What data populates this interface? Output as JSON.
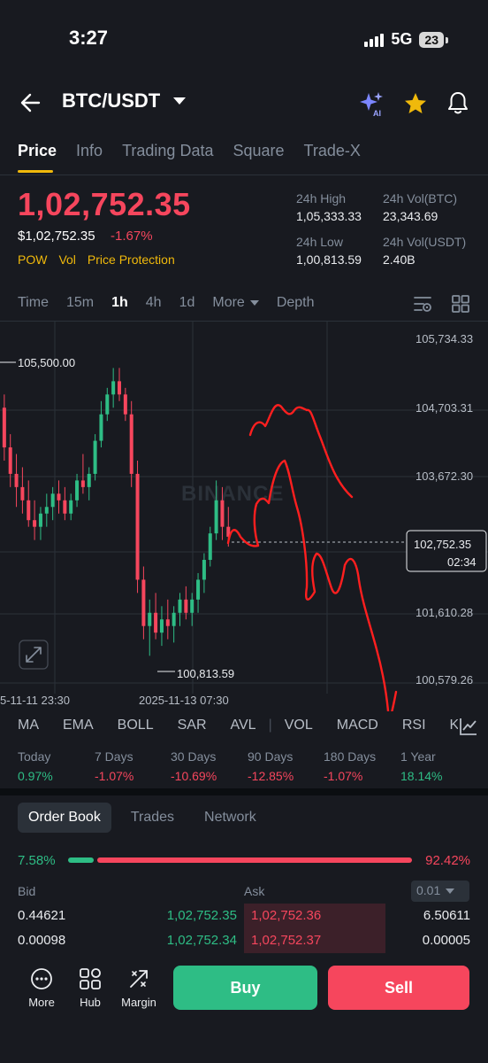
{
  "status_bar": {
    "time": "3:27",
    "network": "5G",
    "battery": "23"
  },
  "header": {
    "pair": "BTC/USDT",
    "icons": [
      "back-arrow-icon",
      "ai-sparkle-icon",
      "star-icon",
      "bell-icon"
    ]
  },
  "tabs": [
    {
      "label": "Price",
      "active": true
    },
    {
      "label": "Info"
    },
    {
      "label": "Trading Data"
    },
    {
      "label": "Square"
    },
    {
      "label": "Trade-X"
    }
  ],
  "price": {
    "last": "1,02,752.35",
    "fiat": "$1,02,752.35",
    "change": "-1.67%",
    "badges": [
      "POW",
      "Vol",
      "Price Protection"
    ]
  },
  "stats": {
    "high_label": "24h High",
    "high": "1,05,333.33",
    "vol_btc_label": "24h Vol(BTC)",
    "vol_btc": "23,343.69",
    "low_label": "24h Low",
    "low": "1,00,813.59",
    "vol_usdt_label": "24h Vol(USDT)",
    "vol_usdt": "2.40B"
  },
  "intervals": {
    "items": [
      "Time",
      "15m",
      "1h",
      "4h",
      "1d"
    ],
    "active": "1h",
    "more": "More",
    "depth": "Depth"
  },
  "chart": {
    "y_labels": [
      "105,734.33",
      "104,703.31",
      "103,672.30",
      "101,610.28",
      "100,579.26"
    ],
    "x_labels": [
      "5-11-11 23:30",
      "2025-11-13 07:30"
    ],
    "high_marker": "105,500.00",
    "low_marker": "100,813.59",
    "current_price": "102,752.35",
    "countdown": "02:34",
    "watermark": "BINANCE",
    "colors": {
      "up": "#2ebd85",
      "down": "#f6465d",
      "drawing": "#ff1f1f"
    }
  },
  "chart_data": {
    "type": "candlestick",
    "y_axis_ticks": [
      105734.33,
      104703.31,
      103672.3,
      101610.28,
      100579.26
    ],
    "x_axis_ticks": [
      "5-11-11 23:30",
      "2025-11-13 07:30"
    ],
    "marked_high": 105500.0,
    "marked_low": 100813.59,
    "last_price": 102752.35,
    "candles_ohlc": [
      [
        104900,
        105500,
        104400,
        104700
      ],
      [
        104700,
        104900,
        103900,
        104100
      ],
      [
        104100,
        104300,
        103500,
        103700
      ],
      [
        103700,
        104000,
        103200,
        103500
      ],
      [
        103500,
        103800,
        103100,
        103300
      ],
      [
        103300,
        103600,
        102900,
        103000
      ],
      [
        103000,
        103300,
        102700,
        102900
      ],
      [
        102900,
        103200,
        102700,
        103100
      ],
      [
        103100,
        103400,
        102900,
        103200
      ],
      [
        103200,
        103500,
        103000,
        103400
      ],
      [
        103400,
        103600,
        103100,
        103300
      ],
      [
        103300,
        103500,
        103000,
        103100
      ],
      [
        103100,
        103400,
        103000,
        103300
      ],
      [
        103300,
        103700,
        103200,
        103600
      ],
      [
        103600,
        104000,
        103400,
        103500
      ],
      [
        103500,
        103800,
        103300,
        103700
      ],
      [
        103700,
        104300,
        103600,
        104200
      ],
      [
        104200,
        104800,
        104100,
        104600
      ],
      [
        104600,
        105000,
        104500,
        104900
      ],
      [
        104900,
        105300,
        104700,
        105100
      ],
      [
        105100,
        105300,
        104800,
        104900
      ],
      [
        104900,
        105000,
        104500,
        104600
      ],
      [
        104600,
        104800,
        103500,
        103700
      ],
      [
        103700,
        103900,
        101900,
        102100
      ],
      [
        102100,
        102300,
        101200,
        101400
      ],
      [
        101400,
        101800,
        100950,
        101600
      ],
      [
        101600,
        101900,
        101200,
        101300
      ],
      [
        101300,
        101700,
        101100,
        101500
      ],
      [
        101500,
        101800,
        101200,
        101400
      ],
      [
        101400,
        101700,
        101150,
        101600
      ],
      [
        101600,
        101900,
        101400,
        101800
      ],
      [
        101800,
        102000,
        101500,
        101600
      ],
      [
        101600,
        101900,
        101400,
        101800
      ],
      [
        101800,
        102200,
        101600,
        102100
      ],
      [
        102100,
        102500,
        101900,
        102400
      ],
      [
        102400,
        102900,
        102300,
        102800
      ],
      [
        102800,
        103600,
        102700,
        103300
      ],
      [
        103300,
        103500,
        102700,
        102900
      ],
      [
        102900,
        103200,
        102600,
        102750
      ]
    ]
  },
  "indicators": [
    "MA",
    "EMA",
    "BOLL",
    "SAR",
    "AVL",
    "VOL",
    "MACD",
    "RSI",
    "KD"
  ],
  "performance": [
    {
      "label": "Today",
      "value": "0.97%",
      "dir": "up"
    },
    {
      "label": "7 Days",
      "value": "-1.07%",
      "dir": "down"
    },
    {
      "label": "30 Days",
      "value": "-10.69%",
      "dir": "down"
    },
    {
      "label": "90 Days",
      "value": "-12.85%",
      "dir": "down"
    },
    {
      "label": "180 Days",
      "value": "-1.07%",
      "dir": "down"
    },
    {
      "label": "1 Year",
      "value": "18.14%",
      "dir": "up"
    }
  ],
  "order_book": {
    "tabs": [
      "Order Book",
      "Trades",
      "Network"
    ],
    "bid_pct": "7.58%",
    "ask_pct": "92.42%",
    "bid_ratio": 0.0758,
    "bid_label": "Bid",
    "ask_label": "Ask",
    "precision": "0.01",
    "rows": [
      {
        "bid_qty": "0.44621",
        "bid_price": "1,02,752.35",
        "ask_price": "1,02,752.36",
        "ask_qty": "6.50611",
        "ask_depth": 0.58
      },
      {
        "bid_qty": "0.00098",
        "bid_price": "1,02,752.34",
        "ask_price": "1,02,752.37",
        "ask_qty": "0.00005",
        "ask_depth": 0.58
      }
    ]
  },
  "bottom_nav": {
    "more": "More",
    "hub": "Hub",
    "margin": "Margin",
    "buy": "Buy",
    "sell": "Sell"
  }
}
